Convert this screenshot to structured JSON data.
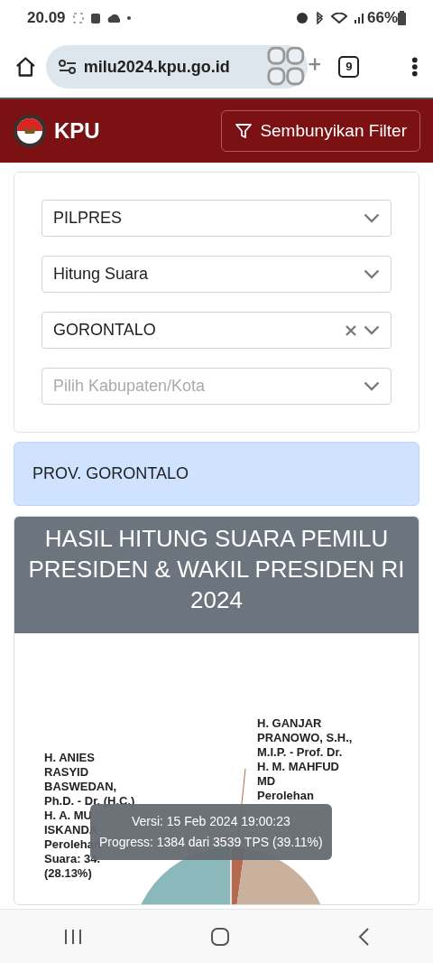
{
  "status_bar": {
    "time": "20.09",
    "battery": "66%"
  },
  "browser": {
    "url": "milu2024.kpu.go.id",
    "tab_count": "9"
  },
  "navbar": {
    "brand": "KPU",
    "filter_button": "Sembunyikan Filter"
  },
  "filters": [
    {
      "value": "PILPRES",
      "clearable": false
    },
    {
      "value": "Hitung Suara",
      "clearable": false
    },
    {
      "value": "GORONTALO",
      "clearable": true
    },
    {
      "placeholder": "Pilih Kabupaten/Kota",
      "clearable": false
    }
  ],
  "region_alert": "PROV. GORONTALO",
  "result_card": {
    "title": "HASIL HITUNG SUARA PEMILU PRESIDEN & WAKIL PRESIDEN RI 2024",
    "pie_labels": [
      {
        "lines": [
          "H. ANIES",
          "RASYID",
          "BASWEDAN,",
          "Ph.D. - Dr. (H.C.)",
          "H. A. MU",
          "ISKANDA",
          "Perolehan",
          "Suara: 34.",
          "(28.13%)"
        ]
      },
      {
        "lines": [
          "H. GANJAR",
          "PRANOWO, S.H.,",
          "M.I.P. - Prof. Dr.",
          "H. M. MAHFUD",
          "MD",
          "Perolehan"
        ]
      }
    ],
    "tooltip": [
      "Versi: 15 Feb 2024 19:00:23",
      "Progress: 1384 dari 3539 TPS (39.11%)"
    ]
  }
}
